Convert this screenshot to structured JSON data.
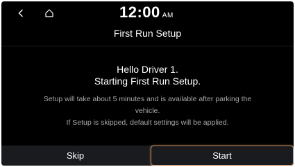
{
  "status_bar": {
    "time": "12:00",
    "ampm": "AM",
    "back_icon": "chevron-left-icon",
    "home_icon": "home-icon"
  },
  "title": "First Run Setup",
  "greeting": {
    "line1": "Hello Driver 1.",
    "line2": "Starting First Run Setup."
  },
  "info": {
    "line1": "Setup will take about 5 minutes and is available after parking the",
    "line2": "vehicle.",
    "line3": "If Setup is skipped, default settings will be applied."
  },
  "buttons": {
    "skip_label": "Skip",
    "start_label": "Start"
  },
  "colors": {
    "background": "#000000",
    "bottom_bar": "#1a1b1e",
    "accent_border": "#c58a5e",
    "info_text": "#a8a8a8"
  }
}
